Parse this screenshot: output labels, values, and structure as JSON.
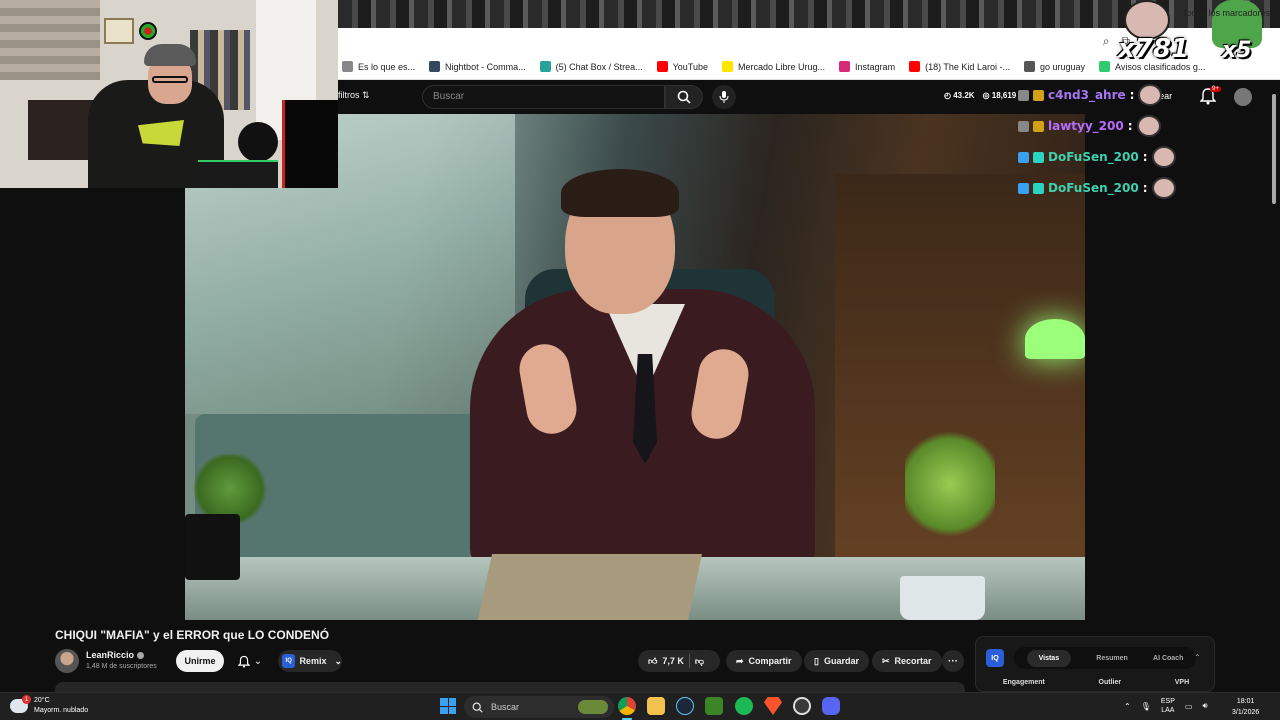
{
  "browser": {
    "bookmarks": [
      {
        "label": "Es lo que es...",
        "icon": "page-icon",
        "color": "#888888"
      },
      {
        "label": "Nightbot - Comma...",
        "icon": "nightbot-icon",
        "color": "#34495e"
      },
      {
        "label": "(5) Chat Box / Strea...",
        "icon": "chatbox-icon",
        "color": "#2aa198"
      },
      {
        "label": "YouTube",
        "icon": "youtube-icon",
        "color": "#ff0000"
      },
      {
        "label": "Mercado Libre Urug...",
        "icon": "mercadolibre-icon",
        "color": "#ffe600"
      },
      {
        "label": "Instagram",
        "icon": "instagram-icon",
        "color": "#d62976"
      },
      {
        "label": "(18) The Kid Laroi -...",
        "icon": "youtube-icon",
        "color": "#ff0000"
      },
      {
        "label": "go uruguay",
        "icon": "globe-icon",
        "color": "#555555"
      },
      {
        "label": "Avisos clasificados g...",
        "icon": "gallito-icon",
        "color": "#2ecc71"
      }
    ],
    "all_bookmarks": "Todos los marcadores"
  },
  "overlays": {
    "emote1_count": "x781",
    "emote2_count": "x5"
  },
  "youtube": {
    "filters_label": "filtros",
    "search_placeholder": "Buscar",
    "stat_1": "43.2K",
    "stat_2": "18,619",
    "create_label": "Crear",
    "notifications_badge": "9+",
    "video": {
      "title": "CHIQUI \"MAFIA\" y el ERROR que LO CONDENÓ",
      "channel": "LeanRiccio",
      "subscribers": "1,48 M de suscriptores",
      "join_label": "Unirme",
      "remix_label": "Remix",
      "likes": "7,7 K",
      "share_label": "Compartir",
      "save_label": "Guardar",
      "clip_label": "Recortar"
    }
  },
  "chat": {
    "messages": [
      {
        "user": "c4nd3_ahre",
        "color": "#a675f0"
      },
      {
        "user": "lawtyy_200",
        "color": "#b86cff"
      },
      {
        "user": "DoFuSen_200",
        "color": "#3fd0b0"
      },
      {
        "user": "DoFuSen_200",
        "color": "#3fd0b0"
      }
    ]
  },
  "vidiq": {
    "logo": "IQ",
    "tabs": [
      "Vistas",
      "Resumen",
      "AI Coach"
    ],
    "active_tab": "Vistas",
    "columns": [
      "Engagement",
      "Outlier",
      "VPH"
    ]
  },
  "taskbar": {
    "temperature": "20°C",
    "weather": "Mayorm. nublado",
    "weather_badge": "1",
    "search_label": "Buscar",
    "lang_1": "ESP",
    "lang_2": "LAA",
    "time": "18:01",
    "date": "3/1/2026"
  }
}
